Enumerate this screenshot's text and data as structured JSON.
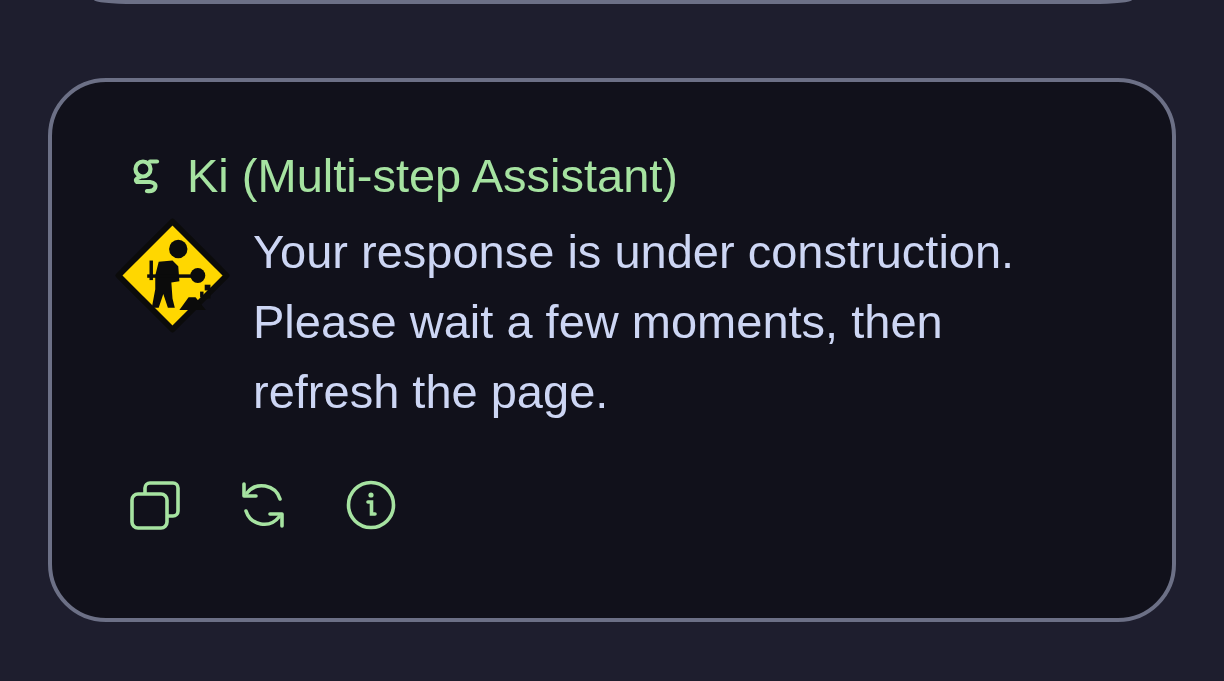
{
  "messages": [
    {
      "kind": "partial"
    },
    {
      "kind": "assistant",
      "author": "Ki (Multi-step Assistant)",
      "body": "Your response is under construction. Please wait a few moments, then refresh the page.",
      "actions": [
        {
          "kind": "copy"
        },
        {
          "kind": "regenerate"
        },
        {
          "kind": "info"
        }
      ]
    }
  ]
}
